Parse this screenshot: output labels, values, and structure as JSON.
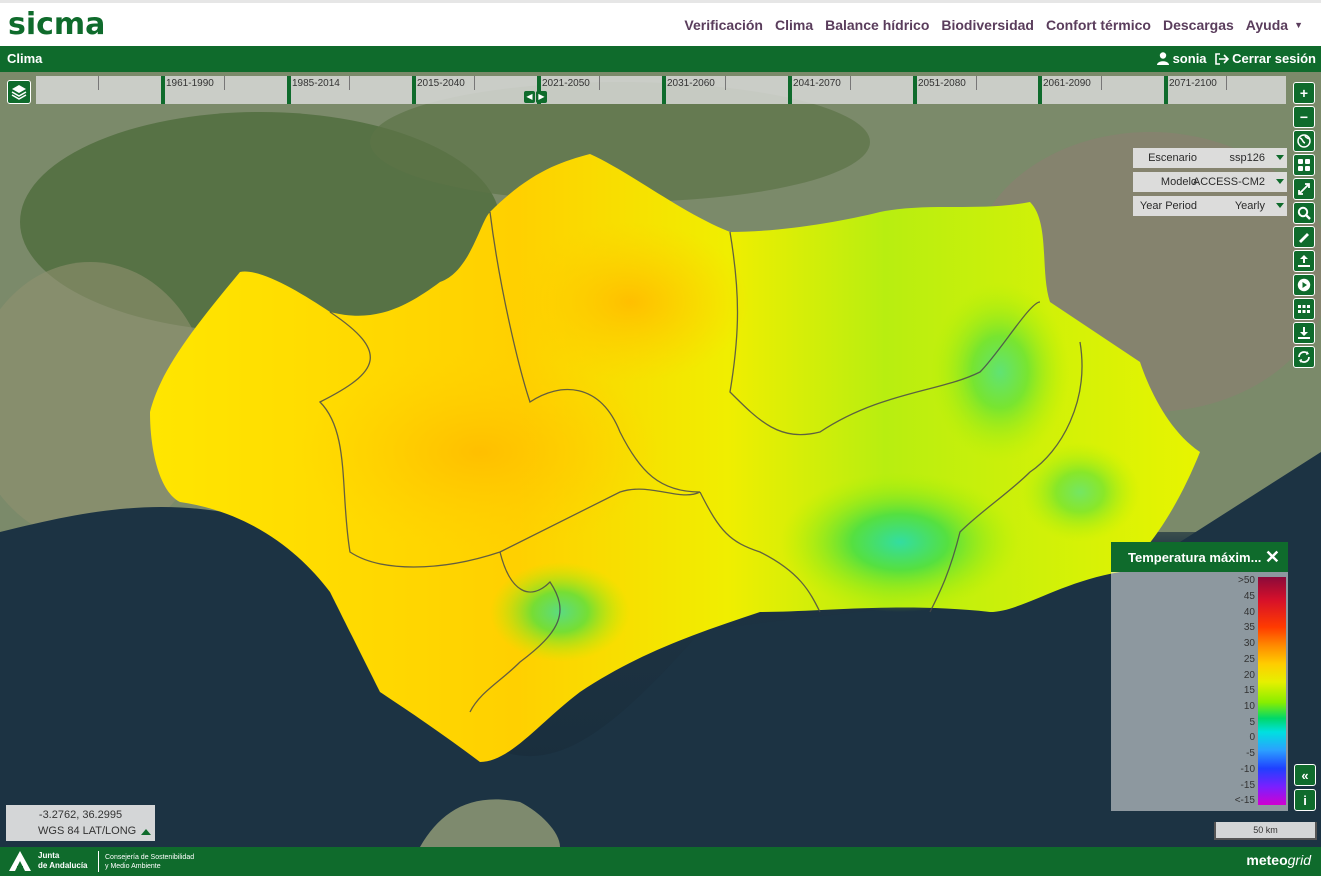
{
  "app": {
    "logo": "sicma"
  },
  "nav": {
    "items": [
      "Verificación",
      "Clima",
      "Balance hídrico",
      "Biodiversidad",
      "Confort térmico",
      "Descargas",
      "Ayuda"
    ]
  },
  "subbar": {
    "title": "Clima",
    "username": "sonia",
    "logout": "Cerrar sesión"
  },
  "timeline": {
    "periods": [
      "1961-1990",
      "1985-2014",
      "2015-2040",
      "2021-2050",
      "2031-2060",
      "2041-2070",
      "2051-2080",
      "2061-2090",
      "2071-2100"
    ],
    "prev_icon": "chevron-left-icon",
    "next_icon": "chevron-right-icon"
  },
  "selectors": [
    {
      "label": "Escenario",
      "value": "ssp126"
    },
    {
      "label": "Modelo",
      "value": "ACCESS-CM2"
    },
    {
      "label": "Year Period",
      "value": "Yearly"
    }
  ],
  "toolbar_icons": [
    "zoom-in-icon",
    "zoom-out-icon",
    "globe-icon",
    "grid-icon",
    "expand-icon",
    "zoom-search-icon",
    "ruler-icon",
    "upload-icon",
    "play-icon",
    "dots-icon",
    "download-icon",
    "refresh-icon"
  ],
  "legend": {
    "title": "Temperatura máxim...",
    "labels": [
      ">50",
      "45",
      "40",
      "35",
      "30",
      "25",
      "20",
      "15",
      "10",
      "5",
      "0",
      "-5",
      "-10",
      "-15",
      "<-15"
    ],
    "colors": {
      "max": "#8b0a3a",
      "mid": "#e6f000",
      "min": "#d000d0"
    }
  },
  "coords": {
    "value": "-3.2762, 36.2995",
    "crs": "WGS 84 LAT/LONG"
  },
  "scale": {
    "label": "50 km"
  },
  "footer": {
    "org_line1": "Junta",
    "org_line2": "de Andalucía",
    "dept_line1": "Consejería de Sostenibilidad",
    "dept_line2": "y Medio Ambiente",
    "brand_a": "meteo",
    "brand_b": "grid"
  },
  "colors": {
    "brand_green": "#0f6b2c",
    "nav_text": "#5a3d5c"
  }
}
